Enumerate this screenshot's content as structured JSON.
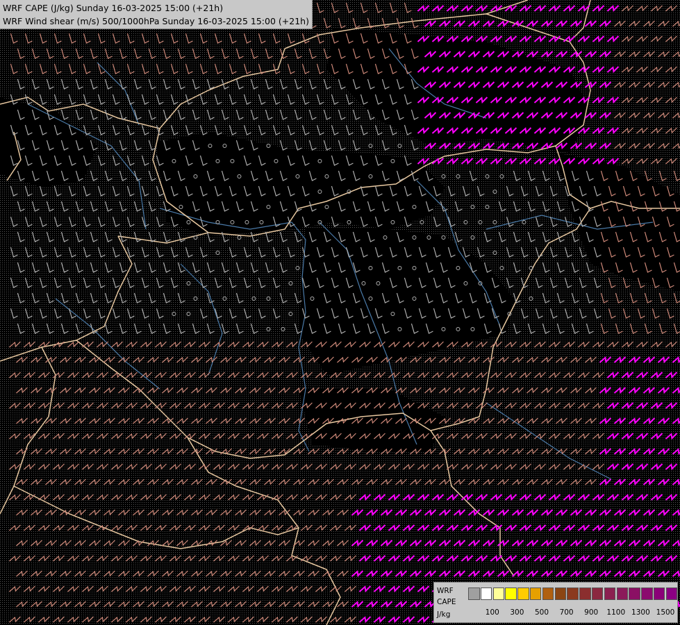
{
  "header": {
    "line1": "WRF CAPE (J/kg) Sunday 16-03-2025 15:00 (+21h)",
    "line2": "WRF Wind shear (m/s) 500/1000hPa Sunday 16-03-2025 15:00 (+21h)"
  },
  "legend": {
    "label_line1": "WRF",
    "label_line2": "CAPE",
    "label_line3": "J/kg",
    "colors": [
      "#a0a0a0",
      "#ffffff",
      "#ffff99",
      "#ffff00",
      "#ffcc00",
      "#e6a000",
      "#b06010",
      "#8b4513",
      "#8b3a1e",
      "#8b2e2e",
      "#8b2840",
      "#8b2050",
      "#8b1a5a",
      "#8b1064",
      "#8b0a6e",
      "#8b0078",
      "#8b0082"
    ],
    "tick_labels": [
      "100",
      "300",
      "500",
      "700",
      "900",
      "1100",
      "1300",
      "1500"
    ]
  },
  "map": {
    "background": "#000000",
    "border_color": "#e8c8a0",
    "river_color": "#4a7aa8",
    "barb_colors": {
      "weak": "#b0b0b0",
      "medium": "#d08a7a",
      "strong": "#ff66a0",
      "very_strong": "#ff00ff"
    }
  }
}
